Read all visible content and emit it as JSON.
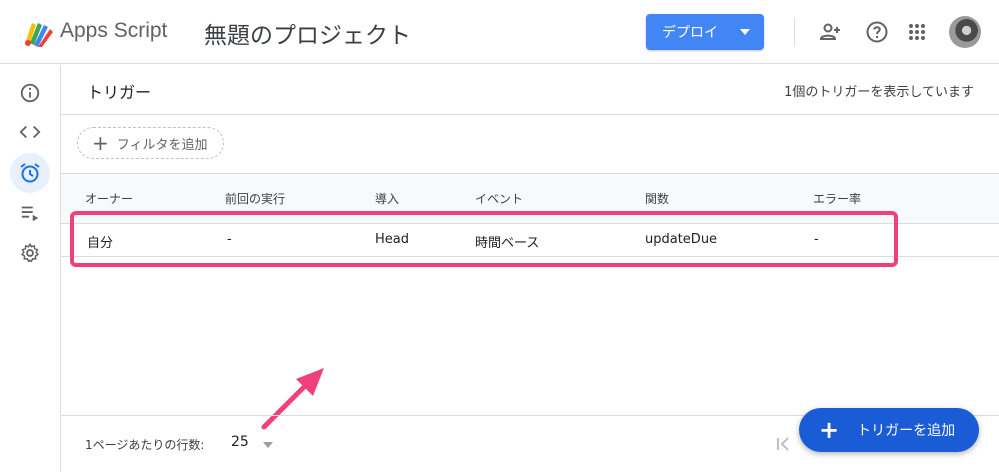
{
  "header": {
    "app_name": "Apps Script",
    "project_title": "無題のプロジェクト",
    "deploy_label": "デプロイ",
    "icons": [
      "add-person-icon",
      "help-icon",
      "apps-grid-icon"
    ]
  },
  "sidebar": {
    "items": [
      {
        "name": "overview",
        "icon": "info-icon"
      },
      {
        "name": "editor",
        "icon": "code-icon"
      },
      {
        "name": "triggers",
        "icon": "alarm-clock-icon",
        "active": true
      },
      {
        "name": "executions",
        "icon": "executions-list-icon"
      },
      {
        "name": "settings",
        "icon": "gear-icon"
      }
    ]
  },
  "main": {
    "title": "トリガー",
    "trigger_count": "1個のトリガーを表示しています",
    "filter_label": "フィルタを追加",
    "columns": [
      "オーナー",
      "前回の実行",
      "導入",
      "イベント",
      "関数",
      "エラー率"
    ],
    "rows": [
      [
        "自分",
        "-",
        "Head",
        "時間ベース",
        "updateDue",
        "-"
      ]
    ]
  },
  "footer": {
    "rows_per_page_label": "1ページあたりの行数:",
    "rows_per_page_value": "25"
  },
  "fab": {
    "label": "トリガーを追加"
  },
  "colors": {
    "accent": "#4285f4",
    "fab": "#1a5cd6",
    "highlight": "#f0407a",
    "active_nav": "#e8f0fe"
  }
}
